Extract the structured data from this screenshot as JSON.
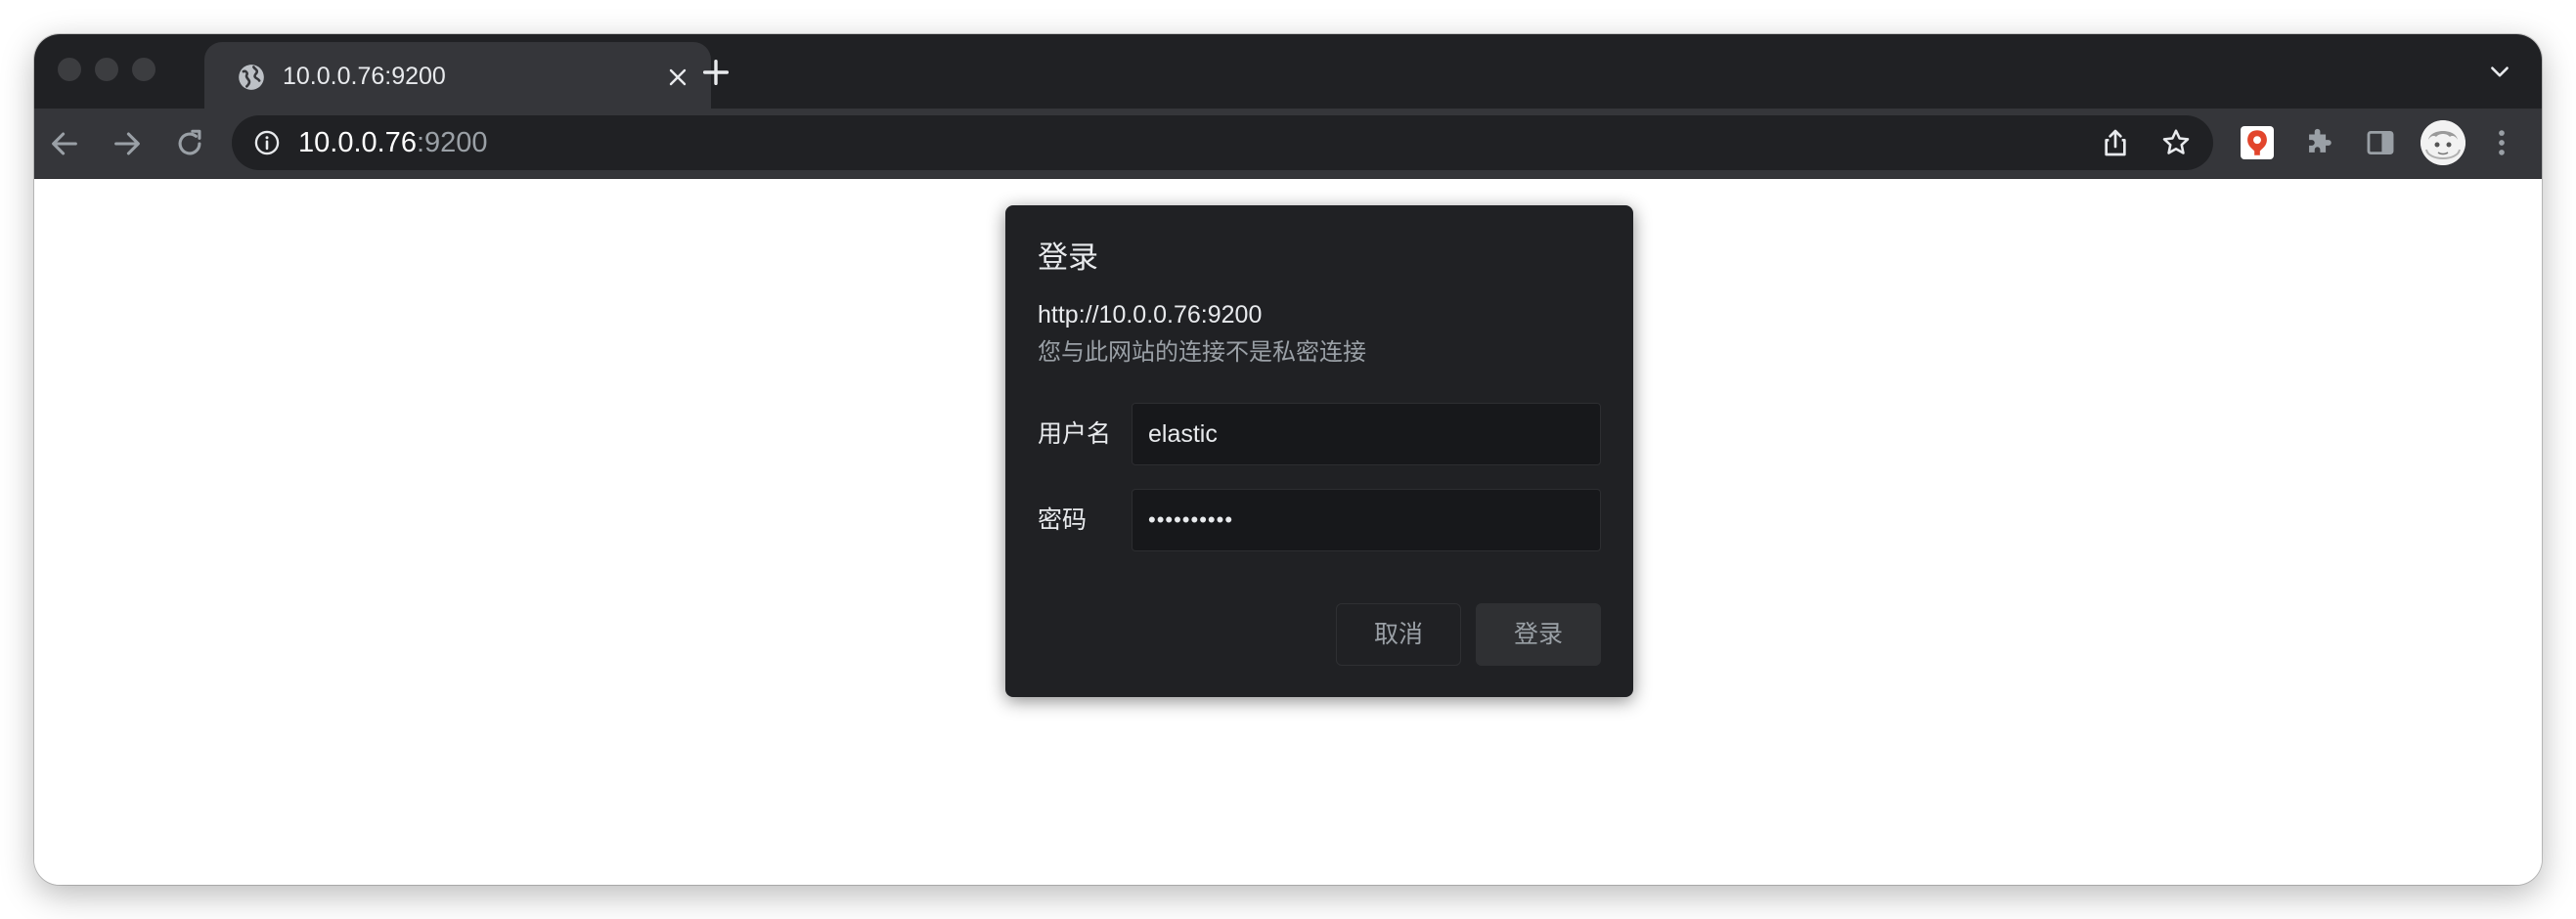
{
  "theme": {
    "tabstrip_bg": "#202124",
    "toolbar_bg": "#35363a",
    "dialog_bg": "#202124",
    "text_primary": "#e8eaed",
    "text_secondary": "#9aa0a6",
    "extension_accent": "#e2452c"
  },
  "tab": {
    "title": "10.0.0.76:9200",
    "favicon": "globe-icon"
  },
  "omnibox": {
    "host": "10.0.0.76",
    "port": ":9200"
  },
  "toolbar": {
    "icons": [
      "back-icon",
      "forward-icon",
      "reload-icon",
      "info-icon",
      "share-icon",
      "star-icon",
      "extension-icon",
      "puzzle-icon",
      "side-panel-icon",
      "avatar",
      "menu-icon"
    ]
  },
  "dialog": {
    "title": "登录",
    "url": "http://10.0.0.76:9200",
    "warning": "您与此网站的连接不是私密连接",
    "username_label": "用户名",
    "username_value": "elastic",
    "password_label": "密码",
    "password_value": "••••••••••",
    "cancel_label": "取消",
    "login_label": "登录"
  }
}
